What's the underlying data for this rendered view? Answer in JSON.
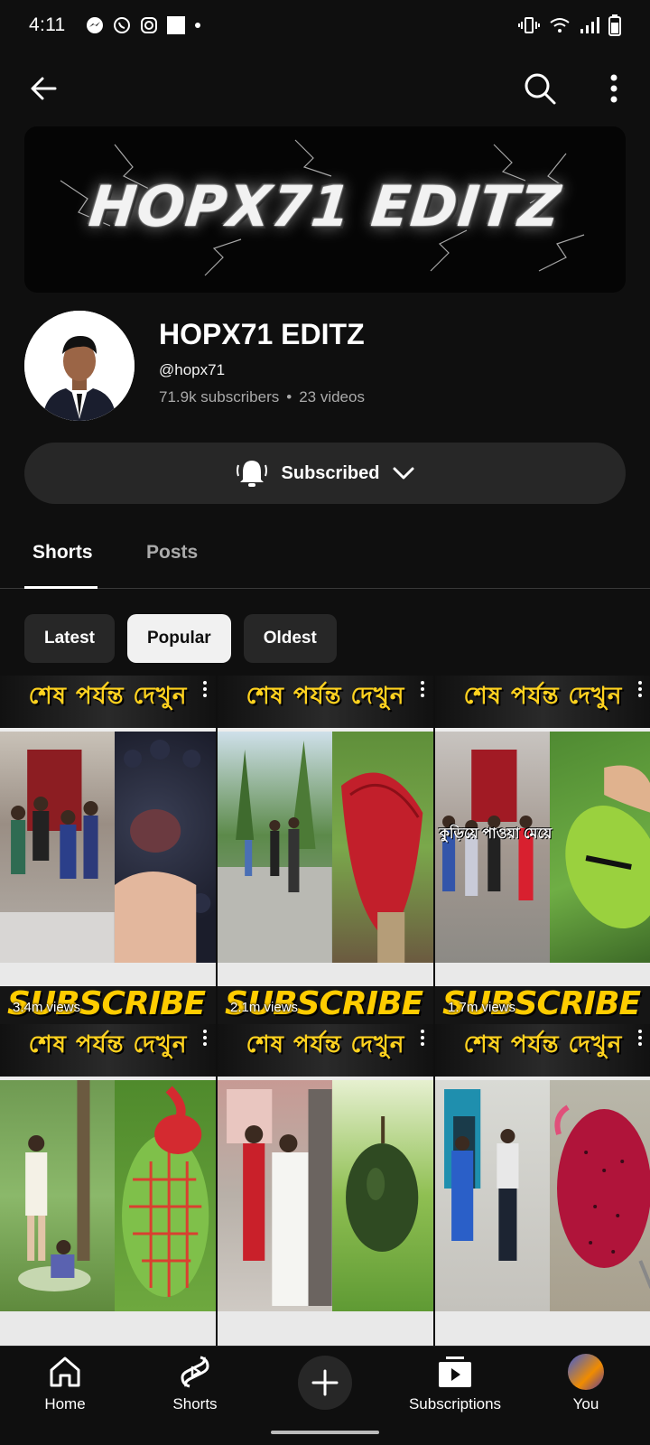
{
  "status_bar": {
    "time": "4:11",
    "left_icons": [
      "messenger-icon",
      "whatsapp-icon",
      "instagram-icon",
      "square-icon",
      "dot-icon"
    ],
    "right_icons": [
      "vibrate-icon",
      "wifi-icon",
      "signal-icon",
      "battery-icon"
    ]
  },
  "top_bar": {
    "icons": [
      "back-arrow-icon",
      "search-icon",
      "more-vert-icon"
    ]
  },
  "channel": {
    "banner_text": "HOPX71 EDITZ",
    "name": "HOPX71 EDITZ",
    "handle": "@hopx71",
    "subscribers": "71.9k subscribers",
    "separator": "•",
    "videos": "23 videos"
  },
  "subscribe_button": {
    "label": "Subscribed",
    "icons": [
      "bell-icon",
      "chevron-down-icon"
    ]
  },
  "tabs": [
    {
      "label": "Shorts",
      "active": true
    },
    {
      "label": "Posts",
      "active": false
    }
  ],
  "chips": [
    {
      "label": "Latest",
      "active": false
    },
    {
      "label": "Popular",
      "active": true
    },
    {
      "label": "Oldest",
      "active": false
    }
  ],
  "shorts": [
    {
      "banner": "শেষ পর্যন্ত দেখুন",
      "strip": "SUBSCRIBE",
      "views": "3.4m views",
      "caption": ""
    },
    {
      "banner": "শেষ পর্যন্ত দেখুন",
      "strip": "SUBSCRIBE",
      "views": "2.1m views",
      "caption": ""
    },
    {
      "banner": "শেষ পর্যন্ত দেখুন",
      "strip": "SUBSCRIBE",
      "views": "1.7m views",
      "caption": "কুড়িয়ে পাওয়া মেয়ে"
    },
    {
      "banner": "শেষ পর্যন্ত দেখুন",
      "strip": "",
      "views": "",
      "caption": ""
    },
    {
      "banner": "শেষ পর্যন্ত দেখুন",
      "strip": "",
      "views": "",
      "caption": ""
    },
    {
      "banner": "শেষ পর্যন্ত দেখুন",
      "strip": "",
      "views": "",
      "caption": ""
    }
  ],
  "bottom_nav": {
    "home": "Home",
    "shorts": "Shorts",
    "subscriptions": "Subscriptions",
    "you": "You"
  },
  "colors": {
    "background": "#0f0f0f",
    "surface": "#272727",
    "secondary_text": "#aaaaaa",
    "thumbnail_accent": "#ffcc00"
  }
}
